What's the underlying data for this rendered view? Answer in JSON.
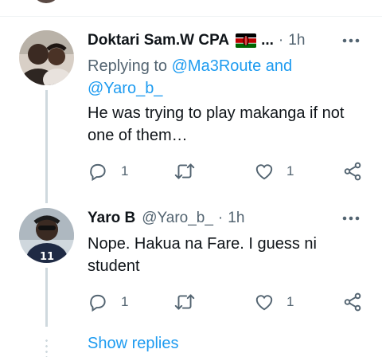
{
  "tweets": [
    {
      "name": "Doktari Sam.W CPA",
      "name_flag_icon": "kenya-flag-icon",
      "name_ellipsis": "...",
      "separator": "·",
      "time": "1h",
      "replying_prefix": "Replying to",
      "replying_mention_1": "@Ma3Route",
      "replying_and": "and",
      "replying_mention_2": "@Yaro_b_",
      "text_line_1": "He was trying to play makanga if not",
      "text_line_2": "one of them…",
      "reply_count": "1",
      "like_count": "1"
    },
    {
      "name": "Yaro B",
      "handle": "@Yaro_b_",
      "separator": "·",
      "time": "1h",
      "text_line_1": "Nope. Hakua na Fare. I guess ni",
      "text_line_2": "student",
      "reply_count": "1",
      "like_count": "1"
    }
  ],
  "show_replies_label": "Show replies",
  "icons": {
    "reply": "reply-icon",
    "retweet": "retweet-icon",
    "like": "heart-icon",
    "share": "share-icon",
    "more": "more-horizontal-icon"
  },
  "colors": {
    "link": "#1d9bf0",
    "secondary_text": "#536471",
    "primary_text": "#0f1419",
    "thread_line": "#cfd9de"
  }
}
